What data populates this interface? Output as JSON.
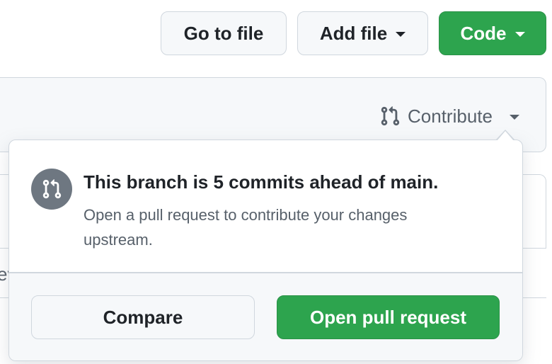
{
  "toolbar": {
    "go_to_file_label": "Go to file",
    "add_file_label": "Add file",
    "code_label": "Code"
  },
  "repo_panel": {
    "contribute_label": "Contribute",
    "contribute_icon": "git-pull-request-icon"
  },
  "file_list": {
    "partial_text": "ev"
  },
  "popover": {
    "icon": "git-pull-request-icon",
    "title": "This branch is 5 commits ahead of main.",
    "description": "Open a pull request to contribute your changes upstream.",
    "compare_label": "Compare",
    "open_pr_label": "Open pull request"
  },
  "colors": {
    "primary_green": "#2da44e",
    "border": "#d0d7de",
    "muted_text": "#57606a",
    "icon_circle": "#6e7781",
    "canvas_subtle": "#f6f8fa"
  }
}
